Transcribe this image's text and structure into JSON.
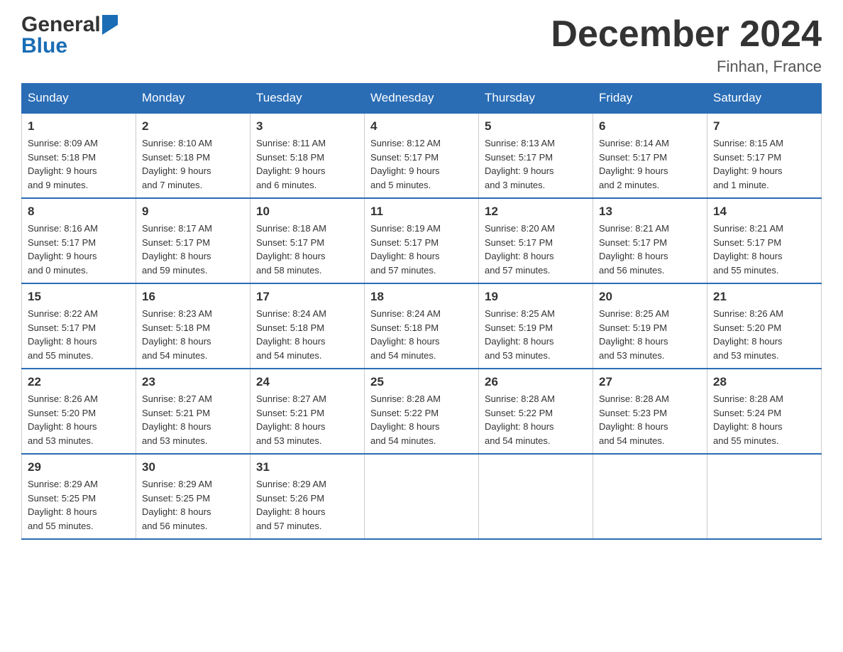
{
  "logo": {
    "general": "General",
    "blue": "Blue",
    "arrow": "▶"
  },
  "title": "December 2024",
  "location": "Finhan, France",
  "days_of_week": [
    "Sunday",
    "Monday",
    "Tuesday",
    "Wednesday",
    "Thursday",
    "Friday",
    "Saturday"
  ],
  "weeks": [
    [
      {
        "day": "1",
        "info": "Sunrise: 8:09 AM\nSunset: 5:18 PM\nDaylight: 9 hours\nand 9 minutes."
      },
      {
        "day": "2",
        "info": "Sunrise: 8:10 AM\nSunset: 5:18 PM\nDaylight: 9 hours\nand 7 minutes."
      },
      {
        "day": "3",
        "info": "Sunrise: 8:11 AM\nSunset: 5:18 PM\nDaylight: 9 hours\nand 6 minutes."
      },
      {
        "day": "4",
        "info": "Sunrise: 8:12 AM\nSunset: 5:17 PM\nDaylight: 9 hours\nand 5 minutes."
      },
      {
        "day": "5",
        "info": "Sunrise: 8:13 AM\nSunset: 5:17 PM\nDaylight: 9 hours\nand 3 minutes."
      },
      {
        "day": "6",
        "info": "Sunrise: 8:14 AM\nSunset: 5:17 PM\nDaylight: 9 hours\nand 2 minutes."
      },
      {
        "day": "7",
        "info": "Sunrise: 8:15 AM\nSunset: 5:17 PM\nDaylight: 9 hours\nand 1 minute."
      }
    ],
    [
      {
        "day": "8",
        "info": "Sunrise: 8:16 AM\nSunset: 5:17 PM\nDaylight: 9 hours\nand 0 minutes."
      },
      {
        "day": "9",
        "info": "Sunrise: 8:17 AM\nSunset: 5:17 PM\nDaylight: 8 hours\nand 59 minutes."
      },
      {
        "day": "10",
        "info": "Sunrise: 8:18 AM\nSunset: 5:17 PM\nDaylight: 8 hours\nand 58 minutes."
      },
      {
        "day": "11",
        "info": "Sunrise: 8:19 AM\nSunset: 5:17 PM\nDaylight: 8 hours\nand 57 minutes."
      },
      {
        "day": "12",
        "info": "Sunrise: 8:20 AM\nSunset: 5:17 PM\nDaylight: 8 hours\nand 57 minutes."
      },
      {
        "day": "13",
        "info": "Sunrise: 8:21 AM\nSunset: 5:17 PM\nDaylight: 8 hours\nand 56 minutes."
      },
      {
        "day": "14",
        "info": "Sunrise: 8:21 AM\nSunset: 5:17 PM\nDaylight: 8 hours\nand 55 minutes."
      }
    ],
    [
      {
        "day": "15",
        "info": "Sunrise: 8:22 AM\nSunset: 5:17 PM\nDaylight: 8 hours\nand 55 minutes."
      },
      {
        "day": "16",
        "info": "Sunrise: 8:23 AM\nSunset: 5:18 PM\nDaylight: 8 hours\nand 54 minutes."
      },
      {
        "day": "17",
        "info": "Sunrise: 8:24 AM\nSunset: 5:18 PM\nDaylight: 8 hours\nand 54 minutes."
      },
      {
        "day": "18",
        "info": "Sunrise: 8:24 AM\nSunset: 5:18 PM\nDaylight: 8 hours\nand 54 minutes."
      },
      {
        "day": "19",
        "info": "Sunrise: 8:25 AM\nSunset: 5:19 PM\nDaylight: 8 hours\nand 53 minutes."
      },
      {
        "day": "20",
        "info": "Sunrise: 8:25 AM\nSunset: 5:19 PM\nDaylight: 8 hours\nand 53 minutes."
      },
      {
        "day": "21",
        "info": "Sunrise: 8:26 AM\nSunset: 5:20 PM\nDaylight: 8 hours\nand 53 minutes."
      }
    ],
    [
      {
        "day": "22",
        "info": "Sunrise: 8:26 AM\nSunset: 5:20 PM\nDaylight: 8 hours\nand 53 minutes."
      },
      {
        "day": "23",
        "info": "Sunrise: 8:27 AM\nSunset: 5:21 PM\nDaylight: 8 hours\nand 53 minutes."
      },
      {
        "day": "24",
        "info": "Sunrise: 8:27 AM\nSunset: 5:21 PM\nDaylight: 8 hours\nand 53 minutes."
      },
      {
        "day": "25",
        "info": "Sunrise: 8:28 AM\nSunset: 5:22 PM\nDaylight: 8 hours\nand 54 minutes."
      },
      {
        "day": "26",
        "info": "Sunrise: 8:28 AM\nSunset: 5:22 PM\nDaylight: 8 hours\nand 54 minutes."
      },
      {
        "day": "27",
        "info": "Sunrise: 8:28 AM\nSunset: 5:23 PM\nDaylight: 8 hours\nand 54 minutes."
      },
      {
        "day": "28",
        "info": "Sunrise: 8:28 AM\nSunset: 5:24 PM\nDaylight: 8 hours\nand 55 minutes."
      }
    ],
    [
      {
        "day": "29",
        "info": "Sunrise: 8:29 AM\nSunset: 5:25 PM\nDaylight: 8 hours\nand 55 minutes."
      },
      {
        "day": "30",
        "info": "Sunrise: 8:29 AM\nSunset: 5:25 PM\nDaylight: 8 hours\nand 56 minutes."
      },
      {
        "day": "31",
        "info": "Sunrise: 8:29 AM\nSunset: 5:26 PM\nDaylight: 8 hours\nand 57 minutes."
      },
      {
        "day": "",
        "info": ""
      },
      {
        "day": "",
        "info": ""
      },
      {
        "day": "",
        "info": ""
      },
      {
        "day": "",
        "info": ""
      }
    ]
  ]
}
